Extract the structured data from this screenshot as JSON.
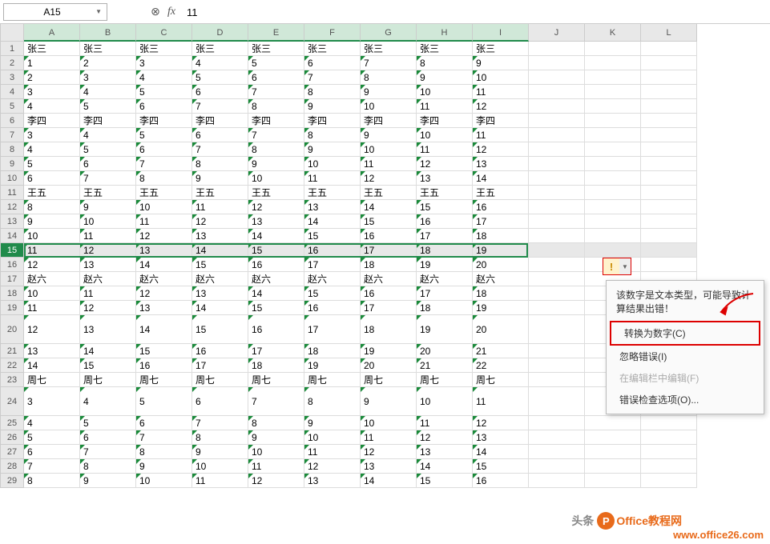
{
  "nameBox": "A15",
  "formula": "11",
  "fxLabel": "fx",
  "columns": [
    "A",
    "B",
    "C",
    "D",
    "E",
    "F",
    "G",
    "H",
    "I",
    "J",
    "K",
    "L"
  ],
  "selectedCols": [
    "A",
    "B",
    "C",
    "D",
    "E",
    "F",
    "G",
    "H",
    "I"
  ],
  "selectedRow": 15,
  "rowNumbers": [
    1,
    2,
    3,
    4,
    5,
    6,
    7,
    8,
    9,
    10,
    11,
    12,
    13,
    14,
    15,
    16,
    17,
    18,
    19,
    20,
    21,
    22,
    23,
    24,
    25,
    26,
    27,
    28,
    29
  ],
  "tallRows": [
    20,
    24
  ],
  "rows": [
    {
      "r": 1,
      "txt": false,
      "c": [
        "张三",
        "张三",
        "张三",
        "张三",
        "张三",
        "张三",
        "张三",
        "张三",
        "张三"
      ]
    },
    {
      "r": 2,
      "txt": true,
      "c": [
        "1",
        "2",
        "3",
        "4",
        "5",
        "6",
        "7",
        "8",
        "9"
      ]
    },
    {
      "r": 3,
      "txt": true,
      "c": [
        "2",
        "3",
        "4",
        "5",
        "6",
        "7",
        "8",
        "9",
        "10"
      ]
    },
    {
      "r": 4,
      "txt": true,
      "c": [
        "3",
        "4",
        "5",
        "6",
        "7",
        "8",
        "9",
        "10",
        "11"
      ]
    },
    {
      "r": 5,
      "txt": true,
      "c": [
        "4",
        "5",
        "6",
        "7",
        "8",
        "9",
        "10",
        "11",
        "12"
      ]
    },
    {
      "r": 6,
      "txt": false,
      "c": [
        "李四",
        "李四",
        "李四",
        "李四",
        "李四",
        "李四",
        "李四",
        "李四",
        "李四"
      ]
    },
    {
      "r": 7,
      "txt": true,
      "c": [
        "3",
        "4",
        "5",
        "6",
        "7",
        "8",
        "9",
        "10",
        "11"
      ]
    },
    {
      "r": 8,
      "txt": true,
      "c": [
        "4",
        "5",
        "6",
        "7",
        "8",
        "9",
        "10",
        "11",
        "12"
      ]
    },
    {
      "r": 9,
      "txt": true,
      "c": [
        "5",
        "6",
        "7",
        "8",
        "9",
        "10",
        "11",
        "12",
        "13"
      ]
    },
    {
      "r": 10,
      "txt": true,
      "c": [
        "6",
        "7",
        "8",
        "9",
        "10",
        "11",
        "12",
        "13",
        "14"
      ]
    },
    {
      "r": 11,
      "txt": false,
      "c": [
        "王五",
        "王五",
        "王五",
        "王五",
        "王五",
        "王五",
        "王五",
        "王五",
        "王五"
      ]
    },
    {
      "r": 12,
      "txt": true,
      "c": [
        "8",
        "9",
        "10",
        "11",
        "12",
        "13",
        "14",
        "15",
        "16"
      ]
    },
    {
      "r": 13,
      "txt": true,
      "c": [
        "9",
        "10",
        "11",
        "12",
        "13",
        "14",
        "15",
        "16",
        "17"
      ]
    },
    {
      "r": 14,
      "txt": true,
      "c": [
        "10",
        "11",
        "12",
        "13",
        "14",
        "15",
        "16",
        "17",
        "18"
      ]
    },
    {
      "r": 15,
      "txt": true,
      "c": [
        "11",
        "12",
        "13",
        "14",
        "15",
        "16",
        "17",
        "18",
        "19"
      ]
    },
    {
      "r": 16,
      "txt": true,
      "c": [
        "12",
        "13",
        "14",
        "15",
        "16",
        "17",
        "18",
        "19",
        "20"
      ]
    },
    {
      "r": 17,
      "txt": false,
      "c": [
        "赵六",
        "赵六",
        "赵六",
        "赵六",
        "赵六",
        "赵六",
        "赵六",
        "赵六",
        "赵六"
      ]
    },
    {
      "r": 18,
      "txt": true,
      "c": [
        "10",
        "11",
        "12",
        "13",
        "14",
        "15",
        "16",
        "17",
        "18"
      ]
    },
    {
      "r": 19,
      "txt": true,
      "c": [
        "11",
        "12",
        "13",
        "14",
        "15",
        "16",
        "17",
        "18",
        "19"
      ]
    },
    {
      "r": 20,
      "txt": true,
      "c": [
        "12",
        "13",
        "14",
        "15",
        "16",
        "17",
        "18",
        "19",
        "20"
      ]
    },
    {
      "r": 21,
      "txt": true,
      "c": [
        "13",
        "14",
        "15",
        "16",
        "17",
        "18",
        "19",
        "20",
        "21"
      ]
    },
    {
      "r": 22,
      "txt": true,
      "c": [
        "14",
        "15",
        "16",
        "17",
        "18",
        "19",
        "20",
        "21",
        "22"
      ]
    },
    {
      "r": 23,
      "txt": false,
      "c": [
        "周七",
        "周七",
        "周七",
        "周七",
        "周七",
        "周七",
        "周七",
        "周七",
        "周七"
      ]
    },
    {
      "r": 24,
      "txt": true,
      "c": [
        "3",
        "4",
        "5",
        "6",
        "7",
        "8",
        "9",
        "10",
        "11"
      ]
    },
    {
      "r": 25,
      "txt": true,
      "c": [
        "4",
        "5",
        "6",
        "7",
        "8",
        "9",
        "10",
        "11",
        "12"
      ]
    },
    {
      "r": 26,
      "txt": true,
      "c": [
        "5",
        "6",
        "7",
        "8",
        "9",
        "10",
        "11",
        "12",
        "13"
      ]
    },
    {
      "r": 27,
      "txt": true,
      "c": [
        "6",
        "7",
        "8",
        "9",
        "10",
        "11",
        "12",
        "13",
        "14"
      ]
    },
    {
      "r": 28,
      "txt": true,
      "c": [
        "7",
        "8",
        "9",
        "10",
        "11",
        "12",
        "13",
        "14",
        "15"
      ]
    },
    {
      "r": 29,
      "txt": true,
      "c": [
        "8",
        "9",
        "10",
        "11",
        "12",
        "13",
        "14",
        "15",
        "16"
      ]
    }
  ],
  "warnGlyph": "!",
  "warnDrop": "▼",
  "menu": {
    "header": "该数字是文本类型，可能导致计算结果出错！",
    "items": [
      {
        "label": "转换为数字(C)",
        "hl": true,
        "disabled": false
      },
      {
        "label": "忽略错误(I)",
        "hl": false,
        "disabled": false
      },
      {
        "label": "在编辑栏中编辑(F)",
        "hl": false,
        "disabled": true
      },
      {
        "label": "错误检查选项(O)...",
        "hl": false,
        "disabled": false
      }
    ]
  },
  "watermark": {
    "prefix": "头条",
    "badge": "P",
    "brand": "Office教程网",
    "url": "www.office26.com"
  }
}
